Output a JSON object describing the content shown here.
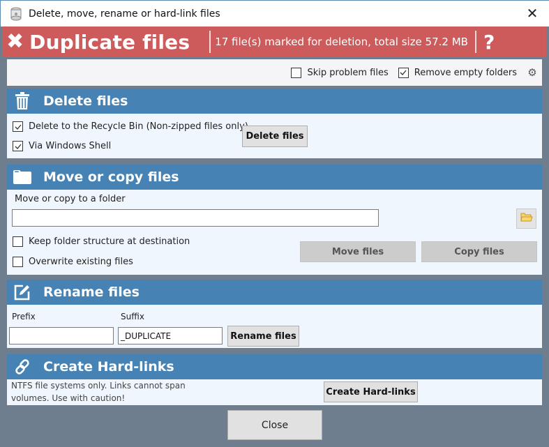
{
  "window": {
    "title": "Delete, move, rename or hard-link files",
    "close_icon": "close-icon"
  },
  "banner": {
    "icon": "x-mark-icon",
    "title": "Duplicate files",
    "message": "17 file(s) marked for deletion, total size 57.2 MB",
    "help_label": "?",
    "color": "#cd5b5b"
  },
  "options": {
    "skip_problem_files": {
      "label": "Skip problem files",
      "checked": false
    },
    "remove_empty_folders": {
      "label": "Remove empty folders",
      "checked": true
    },
    "settings_icon": "gear-icon"
  },
  "sections": {
    "delete": {
      "title": "Delete files",
      "icon": "trash-icon",
      "recycle_bin": {
        "label": "Delete to the Recycle Bin (Non-zipped files only)",
        "checked": true
      },
      "windows_shell": {
        "label": "Via Windows Shell",
        "checked": true
      },
      "button": "Delete files"
    },
    "move_copy": {
      "title": "Move or copy files",
      "icon": "folder-icon",
      "folder_label": "Move or copy to a folder",
      "folder_value": "",
      "keep_structure": {
        "label": "Keep folder structure at destination",
        "checked": false
      },
      "overwrite": {
        "label": "Overwrite existing files",
        "checked": false
      },
      "move_button": "Move files",
      "copy_button": "Copy files"
    },
    "rename": {
      "title": "Rename files",
      "icon": "edit-icon",
      "prefix_label": "Prefix",
      "prefix_value": "",
      "suffix_label": "Suffix",
      "suffix_value": "_DUPLICATE",
      "button": "Rename files"
    },
    "hardlink": {
      "title": "Create Hard-links",
      "icon": "link-icon",
      "note_line1": "NTFS file systems only.  Links cannot span",
      "note_line2": "volumes.  Use with caution!",
      "button": "Create Hard-links"
    }
  },
  "footer": {
    "close_label": "Close"
  },
  "colors": {
    "header_blue": "#4682b4",
    "body_bg": "#eff6fd",
    "frame": "#6e7e8e"
  }
}
